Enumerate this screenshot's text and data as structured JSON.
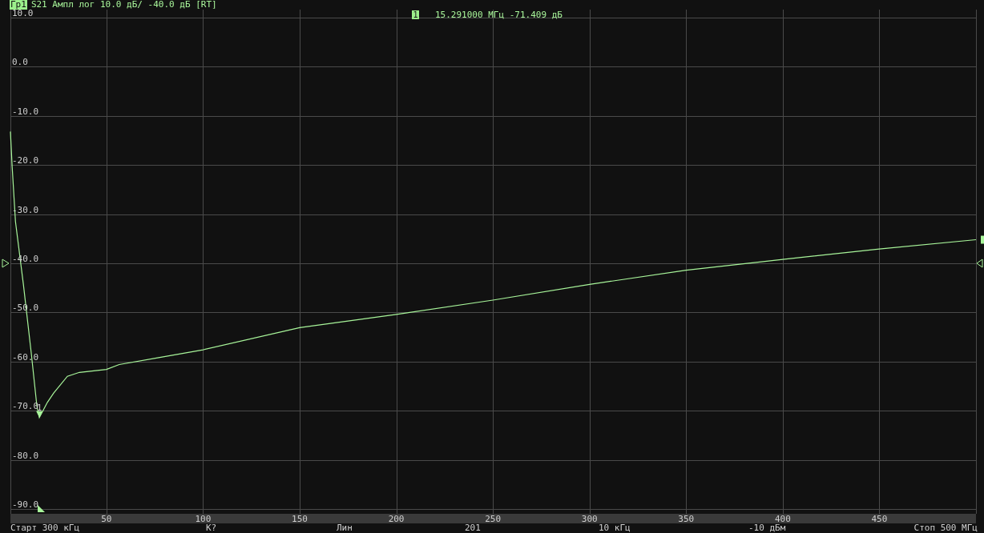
{
  "header": {
    "trace_tag": "Гр1",
    "trace_label": "S21 Ампл лог 10.0 дБ/ -40.0 дБ [RT]"
  },
  "marker_readout": {
    "number": "1",
    "value": "15.291000 МГц -71.409 дБ"
  },
  "chart_data": {
    "type": "line",
    "grid": true,
    "xlim": [
      0.3,
      500
    ],
    "ylim": [
      -90,
      10
    ],
    "xticks": [
      50,
      100,
      150,
      200,
      250,
      300,
      350,
      400,
      450
    ],
    "yticks": [
      {
        "value": 10,
        "label": "10.0"
      },
      {
        "value": 0,
        "label": "0.0"
      },
      {
        "value": -10,
        "label": "-10.0"
      },
      {
        "value": -20,
        "label": "-20.0"
      },
      {
        "value": -30,
        "label": "-30.0"
      },
      {
        "value": -40,
        "label": "-40.0"
      },
      {
        "value": -50,
        "label": "-50.0"
      },
      {
        "value": -60,
        "label": "-60.0"
      },
      {
        "value": -70,
        "label": "-70.0"
      },
      {
        "value": -80,
        "label": "-80.0"
      },
      {
        "value": -90,
        "label": "-90.0"
      }
    ],
    "x": [
      0.3,
      1.2,
      2.9,
      7,
      11.2,
      14,
      15.291,
      19.4,
      22.7,
      29.8,
      36,
      50,
      56.6,
      77,
      100,
      150,
      200,
      250,
      300,
      350,
      400,
      450,
      500
    ],
    "series": [
      {
        "color": "#a8f59a",
        "values": [
          -13.2,
          -20.4,
          -31.5,
          -44.3,
          -58.7,
          -69,
          -71.4,
          -68.3,
          -66.4,
          -63,
          -62.2,
          -61.6,
          -60.6,
          -59.2,
          -57.6,
          -53.1,
          -50.4,
          -47.5,
          -44.3,
          -41.4,
          -39.2,
          -37.1,
          -35.2
        ]
      }
    ],
    "annotations": [
      {
        "x": 15.291,
        "y": -71.409,
        "text": "1"
      }
    ]
  },
  "status_bar": [
    "Старт 300 кГц",
    "К?",
    "Лин",
    "201",
    "10 кГц",
    "-10 дБм",
    "Стоп 500 МГц"
  ]
}
